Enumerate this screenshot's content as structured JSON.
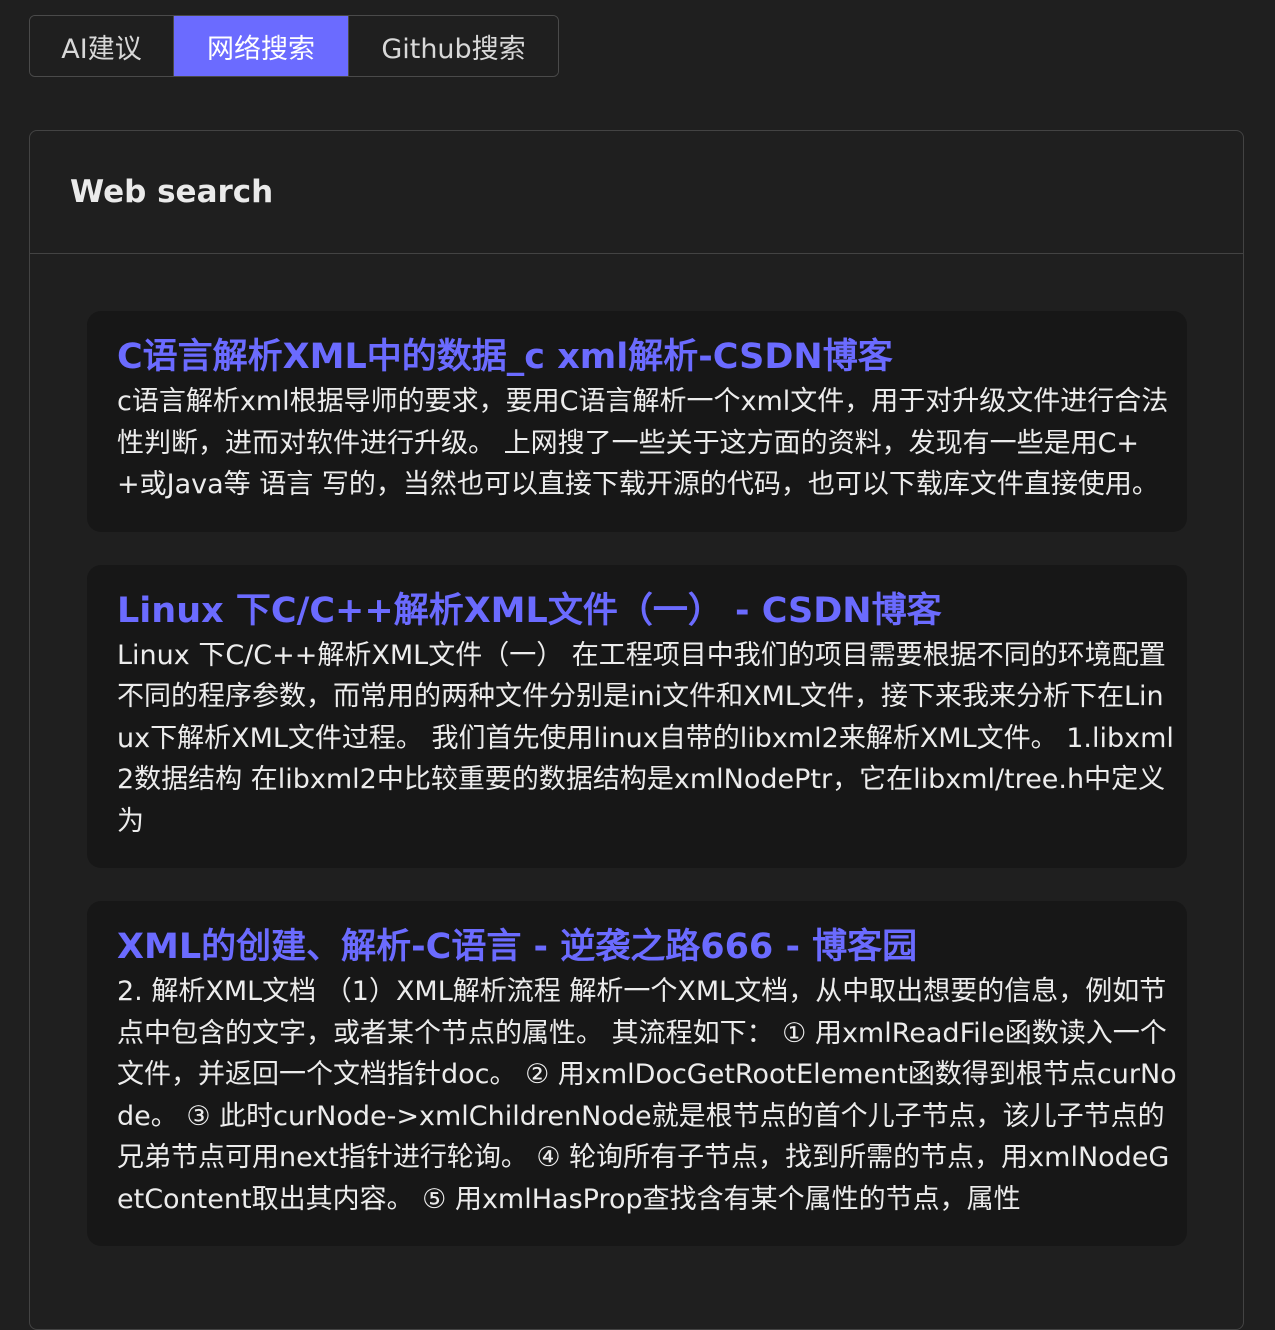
{
  "tabs": [
    {
      "label": "AI建议",
      "active": false
    },
    {
      "label": "网络搜索",
      "active": true
    },
    {
      "label": "Github搜索",
      "active": false
    }
  ],
  "panel": {
    "title": "Web search"
  },
  "results": [
    {
      "title": "C语言解析XML中的数据_c xml解析-CSDN博客",
      "snippet": "c语言解析xml根据导师的要求，要用C语言解析一个xml文件，用于对升级文件进行合法性判断，进而对软件进行升级。 上网搜了一些关于这方面的资料，发现有一些是用C++或Java等 语言 写的，当然也可以直接下载开源的代码，也可以下载库文件直接使用。"
    },
    {
      "title": "Linux 下C/C++解析XML文件（一） - CSDN博客",
      "snippet": "Linux 下C/C++解析XML文件（一） 在工程项目中我们的项目需要根据不同的环境配置不同的程序参数，而常用的两种文件分别是ini文件和XML文件，接下来我来分析下在Linux下解析XML文件过程。 我们首先使用linux自带的libxml2来解析XML文件。 1.libxml2数据结构 在libxml2中比较重要的数据结构是xmlNodePtr，它在libxml/tree.h中定义为"
    },
    {
      "title": "XML的创建、解析-C语言 - 逆袭之路666 - 博客园",
      "snippet": "2. 解析XML文档 （1）XML解析流程 解析一个XML文档，从中取出想要的信息，例如节点中包含的文字，或者某个节点的属性。 其流程如下： ① 用xmlReadFile函数读入一个文件，并返回一个文档指针doc。 ② 用xmlDocGetRootElement函数得到根节点curNode。 ③ 此时curNode->xmlChildrenNode就是根节点的首个儿子节点，该儿子节点的兄弟节点可用next指针进行轮询。 ④ 轮询所有子节点，找到所需的节点，用xmlNodeGetContent取出其内容。 ⑤ 用xmlHasProp查找含有某个属性的节点，属性"
    }
  ]
}
